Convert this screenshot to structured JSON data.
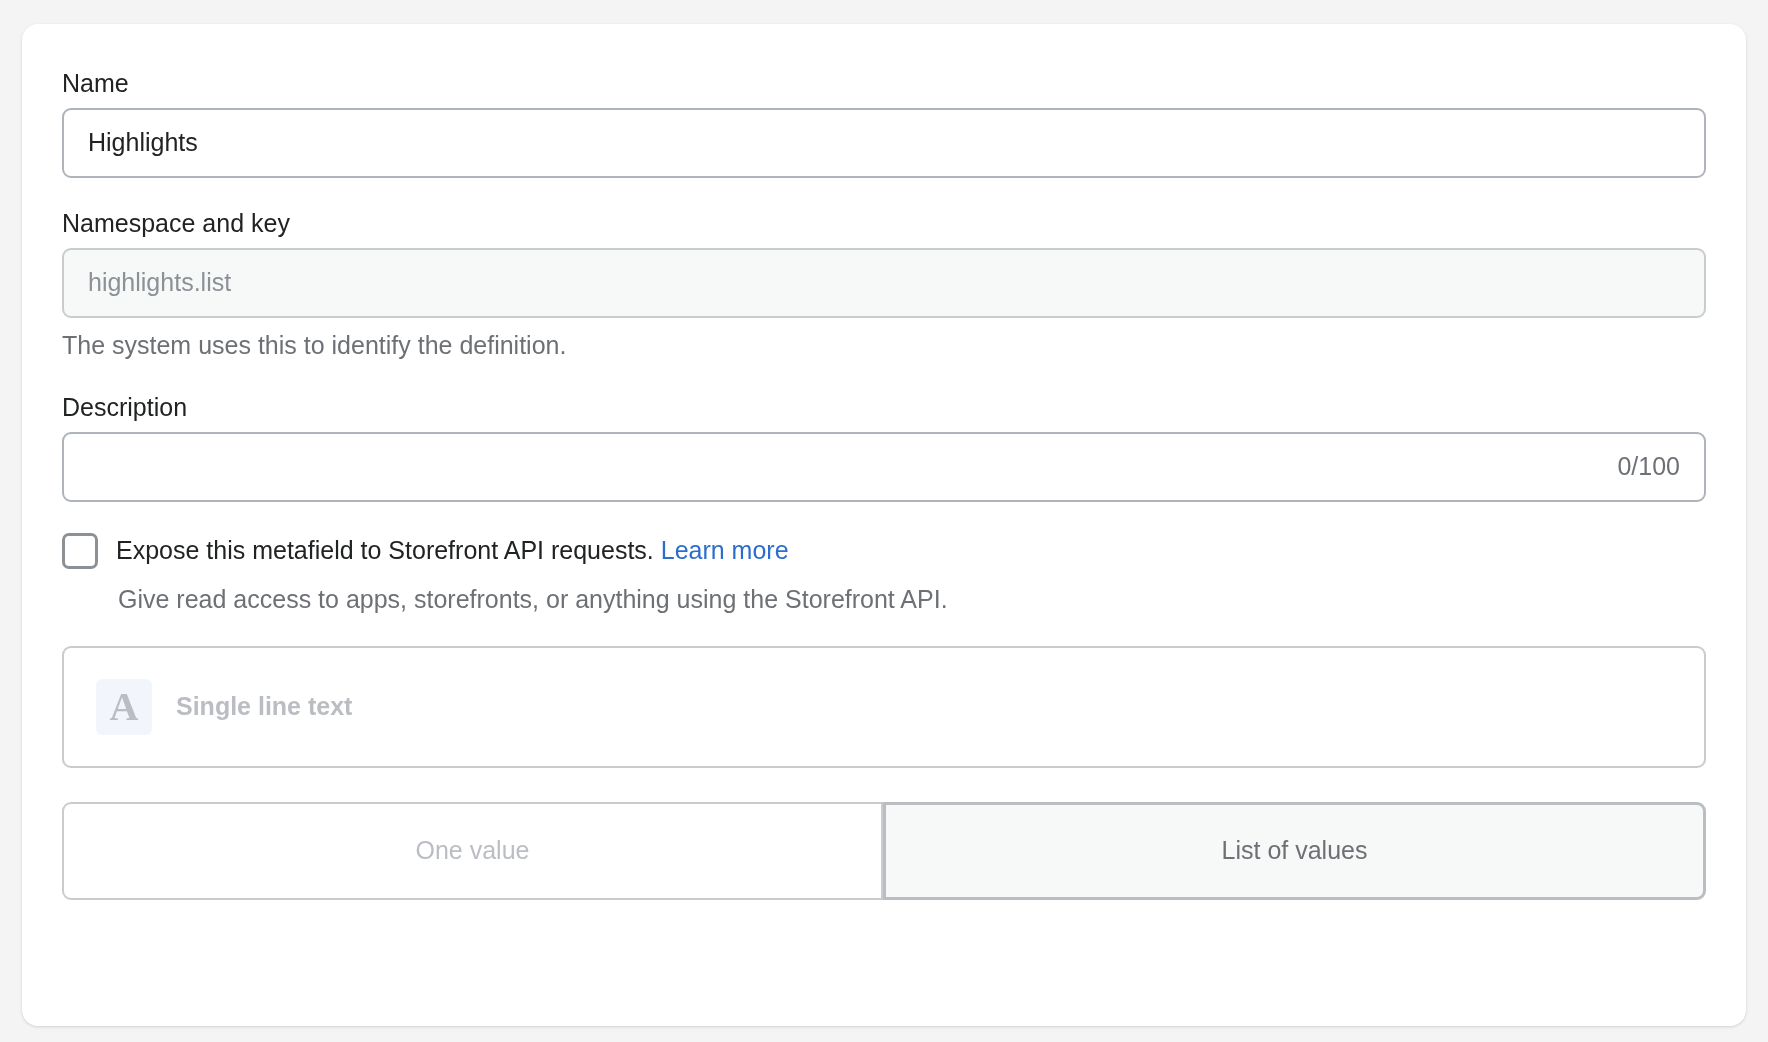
{
  "fields": [
    {
      "kind": "text",
      "label": "Name",
      "value": "Highlights",
      "disabled": false
    },
    {
      "kind": "text",
      "label": "Namespace and key",
      "value": "highlights.list",
      "disabled": true,
      "help": "The system uses this to identify the definition."
    },
    {
      "kind": "counter",
      "label": "Description",
      "counter": "0/100",
      "disabled": false
    }
  ],
  "expose": {
    "checked": false,
    "label": "Expose this metafield to Storefront API requests.",
    "link": "Learn more",
    "help": "Give read access to apps, storefronts, or anything using the Storefront API."
  },
  "type_selector": {
    "icon_letter": "A",
    "label": "Single line text",
    "disabled": true
  },
  "value_options": [
    {
      "label": "One value",
      "selected": false
    },
    {
      "label": "List of values",
      "selected": true
    }
  ]
}
